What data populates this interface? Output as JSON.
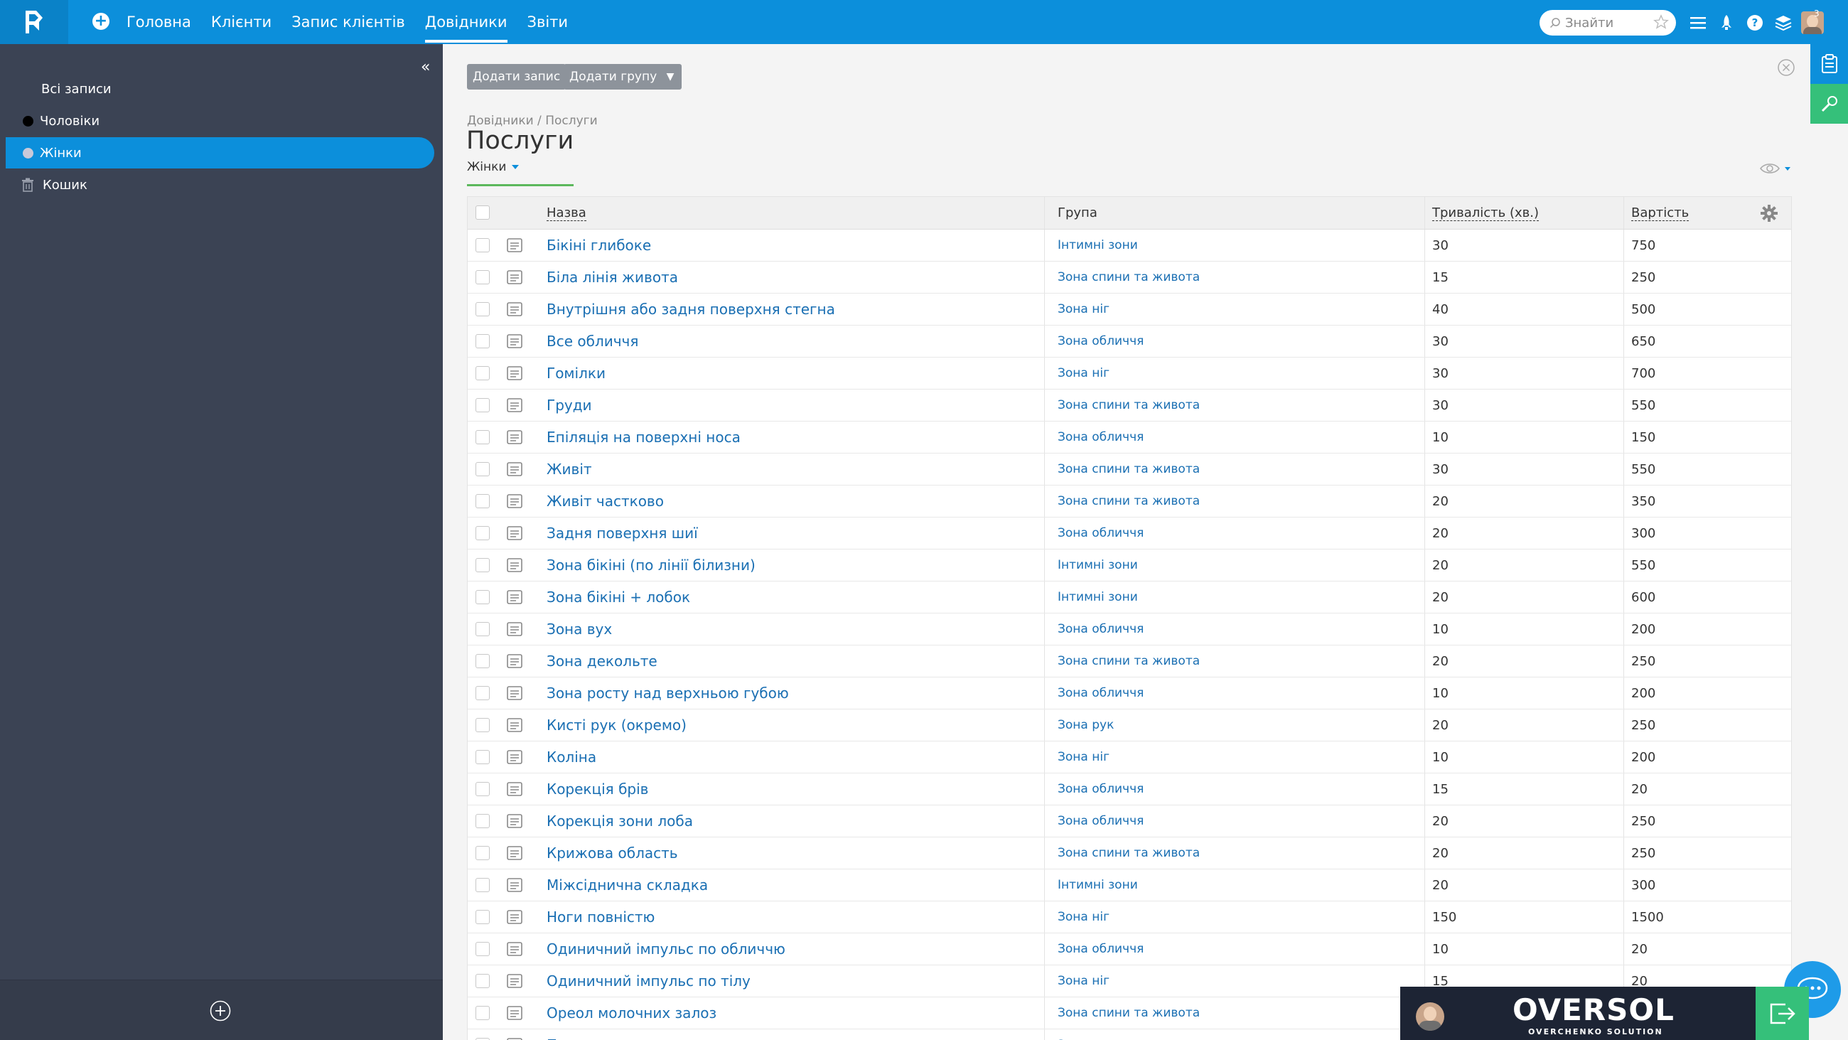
{
  "topbar": {
    "nav": [
      "Головна",
      "Клієнти",
      "Запис клієнтів",
      "Довідники",
      "Звіти"
    ],
    "active_nav": 3,
    "search_placeholder": "Знайти",
    "avatar_badge": "3"
  },
  "sidebar": {
    "items": [
      {
        "label": "Всі записи",
        "dot": ""
      },
      {
        "label": "Чоловіки",
        "dot": "#000000"
      },
      {
        "label": "Жінки",
        "dot": "#c9c9d9"
      },
      {
        "label": "Кошик",
        "dot": "trash"
      }
    ],
    "active_index": 2
  },
  "toolbar": {
    "add_record": "Додати запис",
    "add_group": "Додати групу",
    "dropdown": "▼"
  },
  "breadcrumb": "Довідники / Послуги",
  "page_title": "Послуги",
  "filter_label": "Жінки",
  "table": {
    "headers": {
      "name": "Назва",
      "group": "Група",
      "duration": "Тривалість (хв.)",
      "price": "Вартість"
    },
    "rows": [
      {
        "name": "Бікіні глибоке",
        "group": "Інтимні зони",
        "duration": "30",
        "price": "750"
      },
      {
        "name": "Біла лінія живота",
        "group": "Зона спини та живота",
        "duration": "15",
        "price": "250"
      },
      {
        "name": "Внутрішня або задня поверхня стегна",
        "group": "Зона ніг",
        "duration": "40",
        "price": "500"
      },
      {
        "name": "Все обличчя",
        "group": "Зона обличчя",
        "duration": "30",
        "price": "650"
      },
      {
        "name": "Гомілки",
        "group": "Зона ніг",
        "duration": "30",
        "price": "700"
      },
      {
        "name": "Груди",
        "group": "Зона спини та живота",
        "duration": "30",
        "price": "550"
      },
      {
        "name": "Епіляція на поверхні носа",
        "group": "Зона обличчя",
        "duration": "10",
        "price": "150"
      },
      {
        "name": "Живіт",
        "group": "Зона спини та живота",
        "duration": "30",
        "price": "550"
      },
      {
        "name": "Живіт частково",
        "group": "Зона спини та живота",
        "duration": "20",
        "price": "350"
      },
      {
        "name": "Задня поверхня шиї",
        "group": "Зона обличчя",
        "duration": "20",
        "price": "300"
      },
      {
        "name": "Зона бікіні (по лінії білизни)",
        "group": "Інтимні зони",
        "duration": "20",
        "price": "550"
      },
      {
        "name": "Зона бікіні + лобок",
        "group": "Інтимні зони",
        "duration": "20",
        "price": "600"
      },
      {
        "name": "Зона вух",
        "group": "Зона обличчя",
        "duration": "10",
        "price": "200"
      },
      {
        "name": "Зона декольте",
        "group": "Зона спини та живота",
        "duration": "20",
        "price": "250"
      },
      {
        "name": "Зона росту над верхньою губою",
        "group": "Зона обличчя",
        "duration": "10",
        "price": "200"
      },
      {
        "name": "Кисті рук (окремо)",
        "group": "Зона рук",
        "duration": "20",
        "price": "250"
      },
      {
        "name": "Коліна",
        "group": "Зона ніг",
        "duration": "10",
        "price": "200"
      },
      {
        "name": "Корекція брів",
        "group": "Зона обличчя",
        "duration": "15",
        "price": "20"
      },
      {
        "name": "Корекція зони лоба",
        "group": "Зона обличчя",
        "duration": "20",
        "price": "250"
      },
      {
        "name": "Крижова область",
        "group": "Зона спини та живота",
        "duration": "20",
        "price": "250"
      },
      {
        "name": "Міжсіднична складка",
        "group": "Інтимні зони",
        "duration": "20",
        "price": "300"
      },
      {
        "name": "Ноги повністю",
        "group": "Зона ніг",
        "duration": "150",
        "price": "1500"
      },
      {
        "name": "Одиничний імпульс по обличчю",
        "group": "Зона обличчя",
        "duration": "10",
        "price": "20"
      },
      {
        "name": "Одиничний імпульс по тілу",
        "group": "Зона ніг",
        "duration": "15",
        "price": "20"
      },
      {
        "name": "Ореол молочних залоз",
        "group": "Зона спини та живота",
        "duration": "",
        "price": ""
      },
      {
        "name": "Пахви",
        "group": "Зона рук",
        "duration": "",
        "price": ""
      }
    ]
  },
  "overlay": {
    "brand": "OVERSOL",
    "brand_sub": "OVERCHENKO SOLUTION"
  },
  "colors": {
    "topbar": "#0c8fdb",
    "sidebar": "#3b4354",
    "link": "#1a6fb3",
    "accent_green": "#35c07a"
  }
}
